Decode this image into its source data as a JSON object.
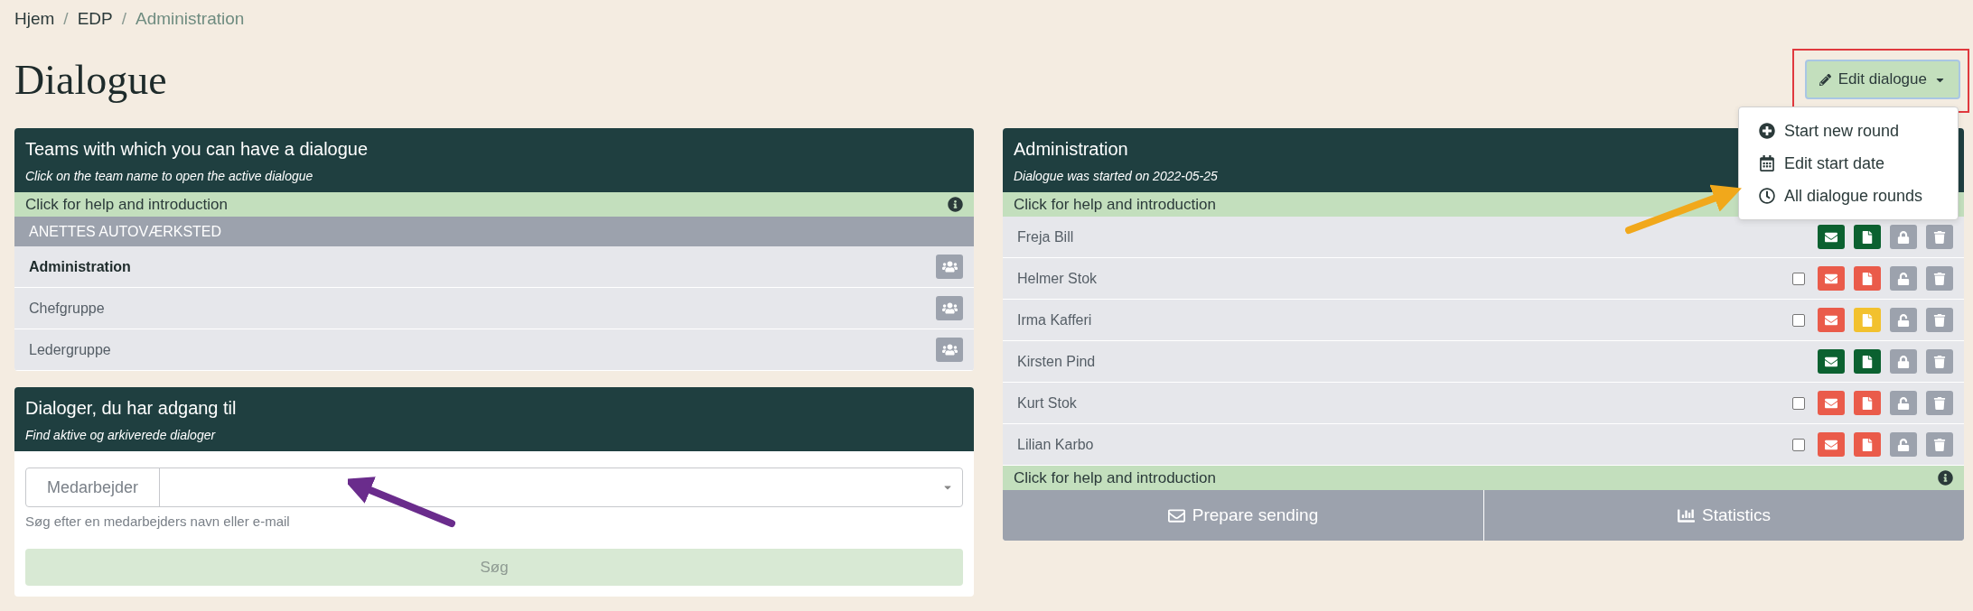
{
  "breadcrumb": [
    {
      "label": "Hjem",
      "current": false
    },
    {
      "separator": "/",
      "label": "EDP",
      "current": false
    },
    {
      "separator": "/",
      "label": "Administration",
      "current": true
    }
  ],
  "page_title": "Dialogue",
  "edit_button": {
    "label": "Edit dialogue",
    "expanded": true,
    "highlighted": true
  },
  "edit_menu": [
    {
      "kind": "plus",
      "label": "Start new round"
    },
    {
      "kind": "calendar",
      "label": "Edit start date"
    },
    {
      "kind": "clock",
      "label": "All dialogue rounds"
    }
  ],
  "teams_panel": {
    "title": "Teams with which you can have a dialogue",
    "subtitle": "Click on the team name to open the active dialogue",
    "help": "Click for help and introduction",
    "group": "ANETTES AUTOVÆRKSTED",
    "teams": [
      {
        "name": "Administration",
        "selected": true
      },
      {
        "name": "Chefgruppe",
        "selected": false
      },
      {
        "name": "Ledergruppe",
        "selected": false
      }
    ]
  },
  "access_panel": {
    "title": "Dialoger, du har adgang til",
    "subtitle": "Find aktive og arkiverede dialoger",
    "field_label": "Medarbejder",
    "hint": "Søg efter en medarbejders navn eller e-mail",
    "search_button": {
      "label": "Søg",
      "disabled": true
    }
  },
  "dialogue_panel": {
    "title": "Administration",
    "subtitle": "Dialogue was started on 2022-05-25",
    "help_top": "Click for help and introduction",
    "help_bottom": "Click for help and introduction",
    "members": [
      {
        "kind": "fixed",
        "name": "Freja Bill",
        "mail": {
          "color": "#0b6130"
        },
        "form": {
          "color": "#0b6130"
        },
        "locked": true
      },
      {
        "kind": "checkbox",
        "name": "Helmer Stok",
        "checked": false,
        "mail": {
          "color": "#ea5b4a"
        },
        "form": {
          "color": "#ea5b4a"
        },
        "locked": false
      },
      {
        "kind": "checkbox",
        "name": "Irma Kafferi",
        "checked": false,
        "mail": {
          "color": "#ea5b4a"
        },
        "form": {
          "color": "#f2c12e"
        },
        "locked": false
      },
      {
        "kind": "fixed",
        "name": "Kirsten Pind",
        "mail": {
          "color": "#0b6130"
        },
        "form": {
          "color": "#0b6130"
        },
        "locked": true
      },
      {
        "kind": "checkbox",
        "name": "Kurt Stok",
        "checked": false,
        "mail": {
          "color": "#ea5b4a"
        },
        "form": {
          "color": "#ea5b4a"
        },
        "locked": false
      },
      {
        "kind": "checkbox",
        "name": "Lilian Karbo",
        "checked": false,
        "mail": {
          "color": "#ea5b4a"
        },
        "form": {
          "color": "#ea5b4a"
        },
        "locked": false
      }
    ],
    "actions": [
      {
        "kind": "mail",
        "label": "Prepare sending"
      },
      {
        "kind": "chart",
        "label": "Statistics"
      }
    ]
  },
  "annotations": [
    {
      "kind": "arrow",
      "color": "#f1a81b"
    },
    {
      "kind": "arrow",
      "color": "#6a2c8c"
    }
  ]
}
